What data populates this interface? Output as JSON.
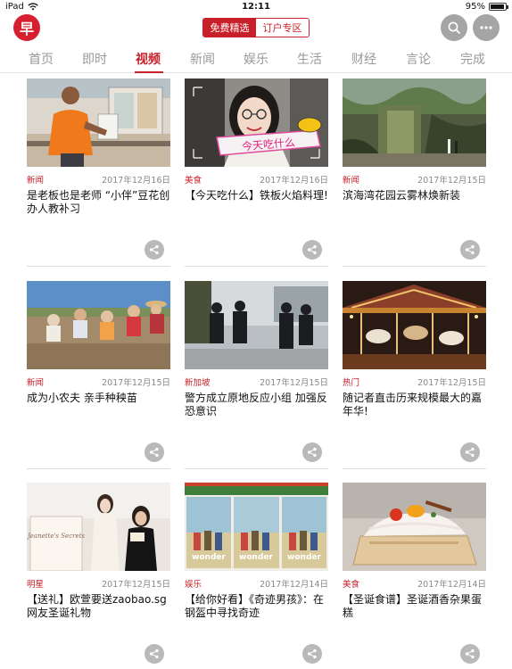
{
  "status": {
    "device": "iPad",
    "time": "12:11",
    "battery": "95%",
    "battery_level": 0.95
  },
  "header": {
    "logo_text": "早",
    "segments": [
      "免费精选",
      "订户专区"
    ],
    "search_icon": "search-icon",
    "more_icon": "more-icon"
  },
  "tabs": [
    "首页",
    "即时",
    "视频",
    "新闻",
    "娱乐",
    "生活",
    "财经",
    "言论",
    "完成"
  ],
  "active_tab": 2,
  "accent": "#c8202a",
  "cards": [
    {
      "category": "新闻",
      "date": "2017年12月16日",
      "title": "是老板也是老师 “小伴”豆花创办人教补习"
    },
    {
      "category": "美食",
      "date": "2017年12月16日",
      "title": "【今天吃什么】铁板火焰料理!"
    },
    {
      "category": "新闻",
      "date": "2017年12月15日",
      "title": "滨海湾花园云雾林焕新装"
    },
    {
      "category": "新闻",
      "date": "2017年12月15日",
      "title": "成为小农夫 亲手种秧苗"
    },
    {
      "category": "新加坡",
      "date": "2017年12月15日",
      "title": "警方成立原地反应小组 加强反恐意识"
    },
    {
      "category": "热门",
      "date": "2017年12月15日",
      "title": "随记者直击历来规模最大的嘉年华!"
    },
    {
      "category": "明星",
      "date": "2017年12月15日",
      "title": "【送礼】欧萱要送zaobao.sg网友圣诞礼物"
    },
    {
      "category": "娱乐",
      "date": "2017年12月14日",
      "title": "【给你好看】《奇迹男孩》：在钢盔中寻找奇迹"
    },
    {
      "category": "美食",
      "date": "2017年12月14日",
      "title": "【圣诞食谱】圣诞酒香杂果蛋糕"
    }
  ],
  "thumb_text": {
    "food_caption": "今天吃什么",
    "juliet_sign": "Jeanette's Secrets",
    "wonder_posters": [
      "wonder",
      "wonder",
      "wonder"
    ]
  }
}
